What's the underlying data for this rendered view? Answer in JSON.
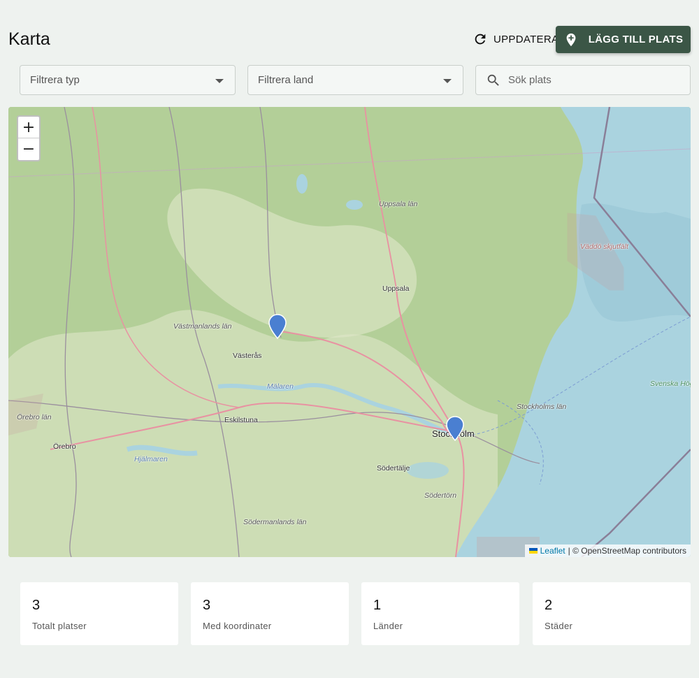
{
  "header": {
    "title": "Karta",
    "refresh_label": "UPPDATERA",
    "add_label": "LÄGG TILL PLATS"
  },
  "filters": {
    "type_placeholder": "Filtrera typ",
    "country_placeholder": "Filtrera land",
    "search_placeholder": "Sök plats"
  },
  "map": {
    "zoom_in": "+",
    "zoom_out": "−",
    "attribution_link": "Leaflet",
    "attribution_text": "| © OpenStreetMap contributors",
    "labels": {
      "uppsala_lan": "Uppsala län",
      "uppsala": "Uppsala",
      "vastmanlands_lan": "Västmanlands län",
      "vasteras": "Västerås",
      "malaren": "Mälaren",
      "orebro_lan": "Örebro län",
      "orebro": "Örebro",
      "eskilstuna": "Eskilstuna",
      "hjalmaren": "Hjälmaren",
      "sodermanlands_lan": "Södermanlands län",
      "sodertalje": "Södertälje",
      "stockholm": "Stockholm",
      "sodertorn": "Södertörn",
      "stockholms_lan": "Stockholms län",
      "vaddo": "Väddö skjutfält",
      "svenska_hogarna": "Svenska Högarna"
    },
    "marker_color": "#4a7fd1"
  },
  "stats": [
    {
      "value": "3",
      "label": "Totalt platser"
    },
    {
      "value": "3",
      "label": "Med koordinater"
    },
    {
      "value": "1",
      "label": "Länder"
    },
    {
      "value": "2",
      "label": "Städer"
    }
  ]
}
